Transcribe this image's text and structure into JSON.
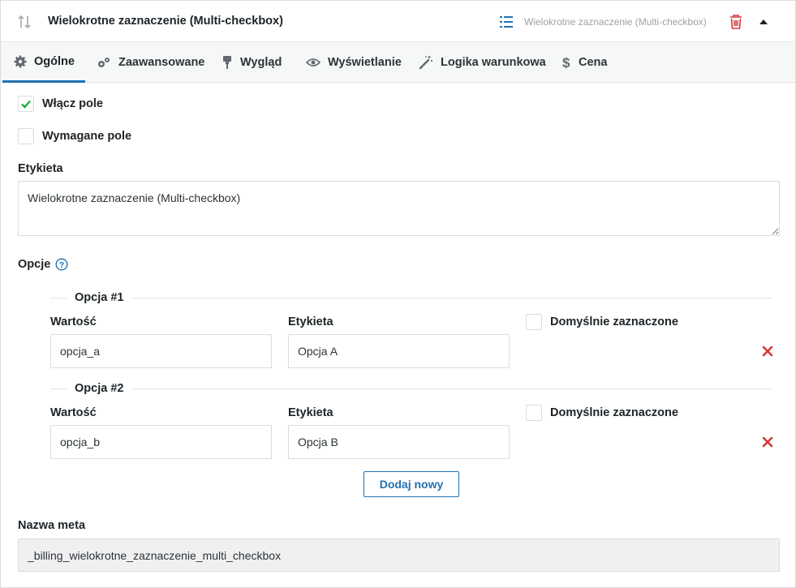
{
  "header": {
    "title": "Wielokrotne zaznaczenie (Multi-checkbox)",
    "field_type": "Wielokrotne zaznaczenie (Multi-checkbox)",
    "icons": [
      "sort-arrows-icon",
      "list-icon",
      "trash-icon",
      "caret-up-icon"
    ]
  },
  "tabs": [
    {
      "label": "Ogólne",
      "icon": "gear-icon",
      "active": true
    },
    {
      "label": "Zaawansowane",
      "icon": "gears-icon",
      "active": false
    },
    {
      "label": "Wygląd",
      "icon": "paint-roller-icon",
      "active": false
    },
    {
      "label": "Wyświetlanie",
      "icon": "eye-icon",
      "active": false
    },
    {
      "label": "Logika warunkowa",
      "icon": "magic-wand-icon",
      "active": false
    },
    {
      "label": "Cena",
      "icon": "dollar-icon",
      "active": false
    }
  ],
  "form": {
    "enable_field": {
      "label": "Włącz pole",
      "checked": true
    },
    "required_field": {
      "label": "Wymagane pole",
      "checked": false
    },
    "label_heading": "Etykieta",
    "label_value": "Wielokrotne zaznaczenie (Multi-checkbox)",
    "options_heading": "Opcje",
    "options": [
      {
        "title": "Opcja #1",
        "value_label": "Wartość",
        "value": "opcja_a",
        "label_label": "Etykieta",
        "label": "Opcja A",
        "default_label": "Domyślnie zaznaczone",
        "default_checked": false
      },
      {
        "title": "Opcja #2",
        "value_label": "Wartość",
        "value": "opcja_b",
        "label_label": "Etykieta",
        "label": "Opcja B",
        "default_label": "Domyślnie zaznaczone",
        "default_checked": false
      }
    ],
    "add_new": "Dodaj nowy",
    "meta_heading": "Nazwa meta",
    "meta_value": "_billing_wielokrotne_zaznaczenie_multi_checkbox"
  },
  "colors": {
    "accent": "#2271b1",
    "danger": "#d63638",
    "check": "#00a32a",
    "muted": "#9ca2a7"
  }
}
